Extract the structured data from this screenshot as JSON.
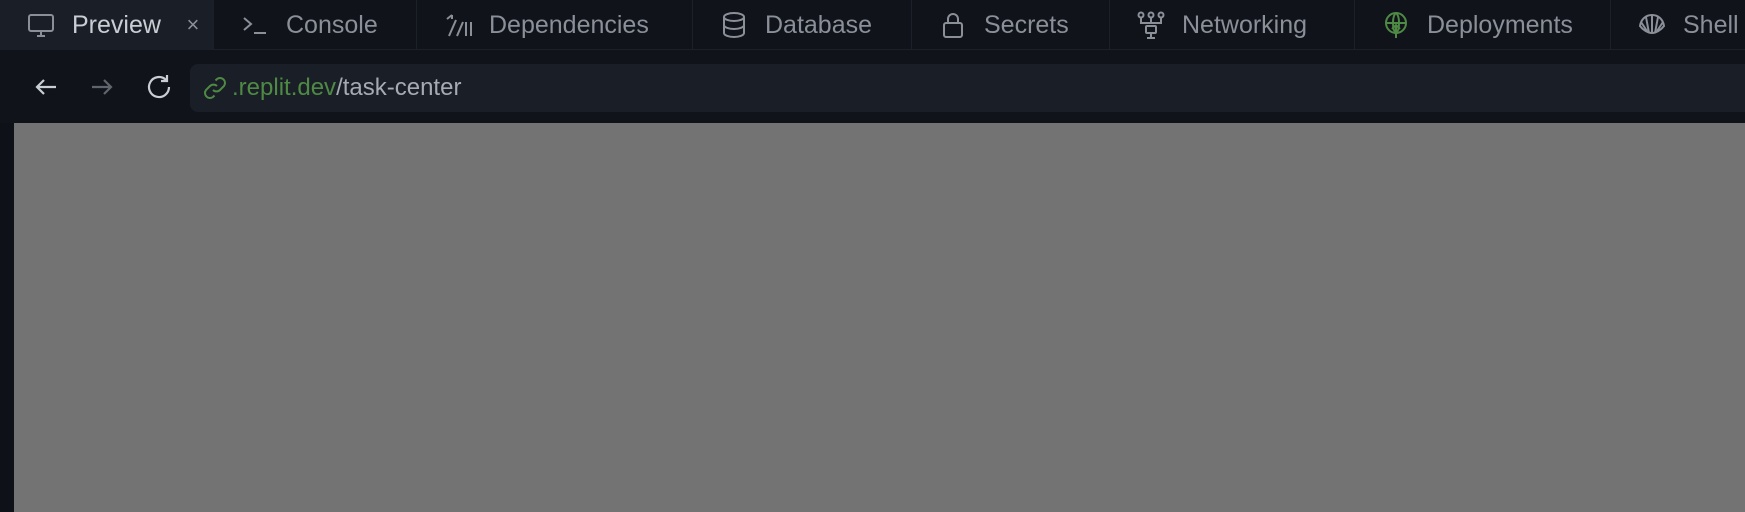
{
  "tabs": [
    {
      "label": "Preview",
      "icon": "monitor-icon",
      "active": true,
      "closable": true
    },
    {
      "label": "Console",
      "icon": "terminal-icon"
    },
    {
      "label": "Dependencies",
      "icon": "dependencies-icon"
    },
    {
      "label": "Database",
      "icon": "database-icon"
    },
    {
      "label": "Secrets",
      "icon": "lock-icon"
    },
    {
      "label": "Networking",
      "icon": "network-icon"
    },
    {
      "label": "Deployments",
      "icon": "globe-icon"
    },
    {
      "label": "Shell",
      "icon": "shell-icon"
    }
  ],
  "close_glyph": "×",
  "address": {
    "domain": ".replit.dev",
    "path": "/task-center"
  },
  "colors": {
    "background": "#0e1117",
    "accent_green": "#4f8a45",
    "preview_area": "#737373"
  }
}
